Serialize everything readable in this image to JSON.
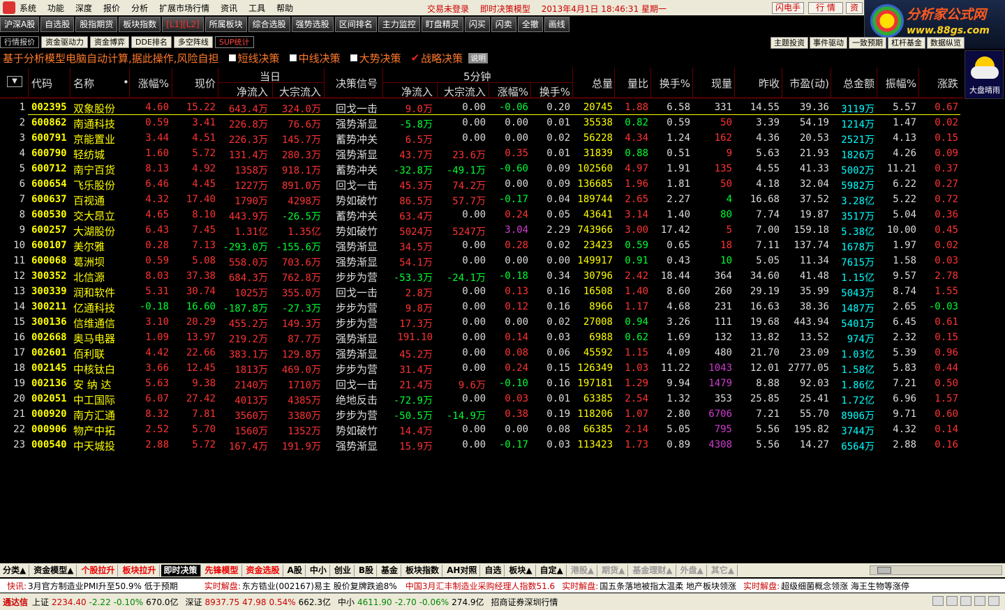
{
  "menu": {
    "items": [
      "系统",
      "功能",
      "深度",
      "报价",
      "分析",
      "扩展市场行情",
      "资讯",
      "工具",
      "帮助"
    ],
    "trade_status": "交易未登录",
    "model_name": "即时决策模型",
    "datetime": "2013年4月1日  18:46:31  星期一",
    "btn_flash": "闪电手",
    "btn_quote": "行 情",
    "btn_info": "资"
  },
  "brand": {
    "title": "分析家公式网",
    "url": "www.88gs.com"
  },
  "toolbar": [
    "沪深A股",
    "自选股",
    "股指期货",
    "板块指数",
    "[L1][L2]",
    "所属板块",
    "综合选股",
    "强势选股",
    "区间排名",
    "主力监控",
    "盯盘精灵",
    "闪买",
    "闪卖",
    "全撤",
    "画线"
  ],
  "tabs": [
    "行情报价",
    "资金驱动力",
    "资金博弈",
    "DDE排名",
    "多空阵线",
    "SUP统计"
  ],
  "right_tabs": [
    "主题投资",
    "事件驱动",
    "一致预期",
    "杠杆基金",
    "数据纵览"
  ],
  "dapan": "大盘晴雨",
  "strip": {
    "description": "基于分析模型电脑自动计算,据此操作,风险自担",
    "options": [
      {
        "label": "短线决策",
        "checked": false
      },
      {
        "label": "中线决策",
        "checked": false
      },
      {
        "label": "大势决策",
        "checked": false
      },
      {
        "label": "战略决策",
        "checked": true
      }
    ],
    "explain": "说明"
  },
  "header": {
    "sort_icon": "▼",
    "code": "代码",
    "name": "名称",
    "dot": "•",
    "chg": "涨幅%",
    "price": "现价",
    "group_day": "当日",
    "net_in": "净流入",
    "big_in": "大宗流入",
    "signal": "决策信号",
    "group_5m": "5分钟",
    "net_in5": "净流入",
    "big_in5": "大宗流入",
    "chg5": "涨幅%",
    "hs5": "换手%",
    "vol": "总量",
    "lb": "量比",
    "hs": "换手%",
    "cur": "现量",
    "pc": "昨收",
    "pe": "市盈(动)",
    "amt": "总金额",
    "amp": "振幅%",
    "zd": "涨跌"
  },
  "rows": [
    {
      "no": "1",
      "code": "002395",
      "name": "双象股份",
      "chg": "4.60",
      "price": "15.22",
      "in": "643.4万",
      "big": "324.0万",
      "sig": "回戈一击",
      "in5": "9.0万",
      "big5": "0.00",
      "chg5": "-0.06",
      "hs5": "0.20",
      "vol": "20745",
      "lb": "1.88",
      "hs": "6.58",
      "cur": "331",
      "pc": "14.55",
      "pe": "39.36",
      "amt": "3119万",
      "amp": "5.57",
      "zd": "0.67",
      "c": [
        "red",
        "red",
        "red",
        "red",
        "red",
        "wht",
        "grn",
        "red",
        "wht",
        "red"
      ]
    },
    {
      "no": "2",
      "code": "600862",
      "name": "南通科技",
      "chg": "0.59",
      "price": "3.41",
      "in": "226.8万",
      "big": "76.6万",
      "sig": "强势渐显",
      "in5": "-5.8万",
      "big5": "0.00",
      "chg5": "0.00",
      "hs5": "0.01",
      "vol": "35538",
      "lb": "0.82",
      "hs": "0.59",
      "cur": "50",
      "pc": "3.39",
      "pe": "54.19",
      "amt": "1214万",
      "amp": "1.47",
      "zd": "0.02",
      "c": [
        "red",
        "red",
        "red",
        "red",
        "grn",
        "wht",
        "wht",
        "grn",
        "red",
        "red"
      ]
    },
    {
      "no": "3",
      "code": "600791",
      "name": "京能置业",
      "chg": "3.44",
      "price": "4.51",
      "in": "226.3万",
      "big": "145.7万",
      "sig": "蓄势冲关",
      "in5": "6.5万",
      "big5": "0.00",
      "chg5": "0.00",
      "hs5": "0.02",
      "vol": "56228",
      "lb": "4.34",
      "hs": "1.24",
      "cur": "162",
      "pc": "4.36",
      "pe": "20.53",
      "amt": "2521万",
      "amp": "4.13",
      "zd": "0.15",
      "c": [
        "red",
        "red",
        "red",
        "red",
        "red",
        "wht",
        "wht",
        "red",
        "red",
        "red"
      ]
    },
    {
      "no": "4",
      "code": "600790",
      "name": "轻纺城",
      "chg": "1.60",
      "price": "5.72",
      "in": "131.4万",
      "big": "280.3万",
      "sig": "强势渐显",
      "in5": "43.7万",
      "big5": "23.6万",
      "chg5": "0.35",
      "hs5": "0.01",
      "vol": "31839",
      "lb": "0.88",
      "hs": "0.51",
      "cur": "9",
      "pc": "5.63",
      "pe": "21.93",
      "amt": "1826万",
      "amp": "4.26",
      "zd": "0.09",
      "c": [
        "red",
        "red",
        "red",
        "red",
        "red",
        "red",
        "red",
        "grn",
        "red",
        "red"
      ]
    },
    {
      "no": "5",
      "code": "600712",
      "name": "南宁百货",
      "chg": "8.13",
      "price": "4.92",
      "in": "1358万",
      "big": "918.1万",
      "sig": "蓄势冲关",
      "in5": "-32.8万",
      "big5": "-49.1万",
      "chg5": "-0.60",
      "hs5": "0.09",
      "vol": "102560",
      "lb": "4.97",
      "hs": "1.91",
      "cur": "135",
      "pc": "4.55",
      "pe": "41.33",
      "amt": "5002万",
      "amp": "11.21",
      "zd": "0.37",
      "c": [
        "red",
        "red",
        "red",
        "red",
        "grn",
        "grn",
        "grn",
        "red",
        "red",
        "red"
      ]
    },
    {
      "no": "6",
      "code": "600654",
      "name": "飞乐股份",
      "chg": "6.46",
      "price": "4.45",
      "in": "1227万",
      "big": "891.0万",
      "sig": "回戈一击",
      "in5": "45.3万",
      "big5": "74.2万",
      "chg5": "0.00",
      "hs5": "0.09",
      "vol": "136685",
      "lb": "1.96",
      "hs": "1.81",
      "cur": "50",
      "pc": "4.18",
      "pe": "32.04",
      "amt": "5982万",
      "amp": "6.22",
      "zd": "0.27",
      "c": [
        "red",
        "red",
        "red",
        "red",
        "red",
        "red",
        "wht",
        "red",
        "red",
        "red"
      ]
    },
    {
      "no": "7",
      "code": "600637",
      "name": "百视通",
      "chg": "4.32",
      "price": "17.40",
      "in": "1790万",
      "big": "4298万",
      "sig": "势如破竹",
      "in5": "86.5万",
      "big5": "57.7万",
      "chg5": "-0.17",
      "hs5": "0.04",
      "vol": "189744",
      "lb": "2.65",
      "hs": "2.27",
      "cur": "4",
      "pc": "16.68",
      "pe": "37.52",
      "amt": "3.28亿",
      "amp": "5.22",
      "zd": "0.72",
      "c": [
        "red",
        "red",
        "red",
        "red",
        "red",
        "red",
        "grn",
        "red",
        "grn",
        "red"
      ]
    },
    {
      "no": "8",
      "code": "600530",
      "name": "交大昂立",
      "chg": "4.65",
      "price": "8.10",
      "in": "443.9万",
      "big": "-26.5万",
      "sig": "蓄势冲关",
      "in5": "63.4万",
      "big5": "0.00",
      "chg5": "0.24",
      "hs5": "0.05",
      "vol": "43641",
      "lb": "3.14",
      "hs": "1.40",
      "cur": "80",
      "pc": "7.74",
      "pe": "19.87",
      "amt": "3517万",
      "amp": "5.04",
      "zd": "0.36",
      "c": [
        "red",
        "red",
        "red",
        "grn",
        "red",
        "wht",
        "red",
        "red",
        "grn",
        "red"
      ]
    },
    {
      "no": "9",
      "code": "600257",
      "name": "大湖股份",
      "chg": "6.43",
      "price": "7.45",
      "in": "1.31亿",
      "big": "1.35亿",
      "sig": "势如破竹",
      "in5": "5024万",
      "big5": "5247万",
      "chg5": "3.04",
      "hs5": "2.29",
      "vol": "743966",
      "lb": "3.00",
      "hs": "17.42",
      "cur": "5",
      "pc": "7.00",
      "pe": "159.18",
      "amt": "5.38亿",
      "amp": "10.00",
      "zd": "0.45",
      "c": [
        "red",
        "red",
        "red",
        "red",
        "red",
        "red",
        "mag",
        "red",
        "red",
        "red"
      ]
    },
    {
      "no": "10",
      "code": "600107",
      "name": "美尔雅",
      "chg": "0.28",
      "price": "7.13",
      "in": "-293.0万",
      "big": "-155.6万",
      "sig": "强势渐显",
      "in5": "34.5万",
      "big5": "0.00",
      "chg5": "0.28",
      "hs5": "0.02",
      "vol": "23423",
      "lb": "0.59",
      "hs": "0.65",
      "cur": "18",
      "pc": "7.11",
      "pe": "137.74",
      "amt": "1678万",
      "amp": "1.97",
      "zd": "0.02",
      "c": [
        "red",
        "red",
        "grn",
        "grn",
        "red",
        "wht",
        "red",
        "grn",
        "red",
        "red"
      ]
    },
    {
      "no": "11",
      "code": "600068",
      "name": "葛洲坝",
      "chg": "0.59",
      "price": "5.08",
      "in": "558.0万",
      "big": "703.6万",
      "sig": "强势渐显",
      "in5": "54.1万",
      "big5": "0.00",
      "chg5": "0.00",
      "hs5": "0.00",
      "vol": "149917",
      "lb": "0.91",
      "hs": "0.43",
      "cur": "10",
      "pc": "5.05",
      "pe": "11.34",
      "amt": "7615万",
      "amp": "1.58",
      "zd": "0.03",
      "c": [
        "red",
        "red",
        "red",
        "red",
        "red",
        "wht",
        "wht",
        "grn",
        "grn",
        "red"
      ]
    },
    {
      "no": "12",
      "code": "300352",
      "name": "北信源",
      "chg": "8.03",
      "price": "37.38",
      "in": "684.3万",
      "big": "762.8万",
      "sig": "步步为营",
      "in5": "-53.3万",
      "big5": "-24.1万",
      "chg5": "-0.18",
      "hs5": "0.34",
      "vol": "30796",
      "lb": "2.42",
      "hs": "18.44",
      "cur": "364",
      "pc": "34.60",
      "pe": "41.48",
      "amt": "1.15亿",
      "amp": "9.57",
      "zd": "2.78",
      "c": [
        "red",
        "red",
        "red",
        "red",
        "grn",
        "grn",
        "grn",
        "red",
        "wht",
        "red"
      ]
    },
    {
      "no": "13",
      "code": "300339",
      "name": "润和软件",
      "chg": "5.31",
      "price": "30.74",
      "in": "1025万",
      "big": "355.0万",
      "sig": "回戈一击",
      "in5": "2.8万",
      "big5": "0.00",
      "chg5": "0.13",
      "hs5": "0.16",
      "vol": "16508",
      "lb": "1.40",
      "hs": "8.60",
      "cur": "260",
      "pc": "29.19",
      "pe": "35.99",
      "amt": "5043万",
      "amp": "8.74",
      "zd": "1.55",
      "c": [
        "red",
        "red",
        "red",
        "red",
        "red",
        "wht",
        "red",
        "red",
        "wht",
        "red"
      ]
    },
    {
      "no": "14",
      "code": "300211",
      "name": "亿通科技",
      "chg": "-0.18",
      "price": "16.60",
      "in": "-187.8万",
      "big": "-27.3万",
      "sig": "步步为营",
      "in5": "9.8万",
      "big5": "0.00",
      "chg5": "0.12",
      "hs5": "0.16",
      "vol": "8966",
      "lb": "1.17",
      "hs": "4.68",
      "cur": "231",
      "pc": "16.63",
      "pe": "38.36",
      "amt": "1487万",
      "amp": "2.65",
      "zd": "-0.03",
      "c": [
        "grn",
        "grn",
        "grn",
        "grn",
        "red",
        "wht",
        "red",
        "red",
        "wht",
        "grn"
      ]
    },
    {
      "no": "15",
      "code": "300136",
      "name": "信维通信",
      "chg": "3.10",
      "price": "20.29",
      "in": "455.2万",
      "big": "149.3万",
      "sig": "步步为营",
      "in5": "17.3万",
      "big5": "0.00",
      "chg5": "0.00",
      "hs5": "0.02",
      "vol": "27008",
      "lb": "0.94",
      "hs": "3.26",
      "cur": "111",
      "pc": "19.68",
      "pe": "443.94",
      "amt": "5401万",
      "amp": "6.45",
      "zd": "0.61",
      "c": [
        "red",
        "red",
        "red",
        "red",
        "red",
        "wht",
        "wht",
        "grn",
        "wht",
        "red"
      ]
    },
    {
      "no": "16",
      "code": "002668",
      "name": "奥马电器",
      "chg": "1.09",
      "price": "13.97",
      "in": "219.2万",
      "big": "87.7万",
      "sig": "强势渐显",
      "in5": "191.10",
      "big5": "0.00",
      "chg5": "0.14",
      "hs5": "0.03",
      "vol": "6988",
      "lb": "0.62",
      "hs": "1.69",
      "cur": "132",
      "pc": "13.82",
      "pe": "13.52",
      "amt": "974万",
      "amp": "2.32",
      "zd": "0.15",
      "c": [
        "red",
        "red",
        "red",
        "red",
        "red",
        "wht",
        "red",
        "grn",
        "wht",
        "red"
      ]
    },
    {
      "no": "17",
      "code": "002601",
      "name": "佰利联",
      "chg": "4.42",
      "price": "22.66",
      "in": "383.1万",
      "big": "129.8万",
      "sig": "强势渐显",
      "in5": "45.2万",
      "big5": "0.00",
      "chg5": "0.08",
      "hs5": "0.06",
      "vol": "45592",
      "lb": "1.15",
      "hs": "4.09",
      "cur": "480",
      "pc": "21.70",
      "pe": "23.09",
      "amt": "1.03亿",
      "amp": "5.39",
      "zd": "0.96",
      "c": [
        "red",
        "red",
        "red",
        "red",
        "red",
        "wht",
        "red",
        "red",
        "wht",
        "red"
      ]
    },
    {
      "no": "18",
      "code": "002145",
      "name": "中核钛白",
      "chg": "3.66",
      "price": "12.45",
      "in": "1813万",
      "big": "469.0万",
      "sig": "步步为营",
      "in5": "31.4万",
      "big5": "0.00",
      "chg5": "0.24",
      "hs5": "0.15",
      "vol": "126349",
      "lb": "1.03",
      "hs": "11.22",
      "cur": "1043",
      "pc": "12.01",
      "pe": "2777.05",
      "amt": "1.58亿",
      "amp": "5.83",
      "zd": "0.44",
      "c": [
        "red",
        "red",
        "red",
        "red",
        "red",
        "wht",
        "red",
        "red",
        "mag",
        "red"
      ]
    },
    {
      "no": "19",
      "code": "002136",
      "name": "安 纳 达",
      "chg": "5.63",
      "price": "9.38",
      "in": "2140万",
      "big": "1710万",
      "sig": "回戈一击",
      "in5": "21.4万",
      "big5": "9.6万",
      "chg5": "-0.10",
      "hs5": "0.16",
      "vol": "197181",
      "lb": "1.29",
      "hs": "9.94",
      "cur": "1479",
      "pc": "8.88",
      "pe": "92.03",
      "amt": "1.86亿",
      "amp": "7.21",
      "zd": "0.50",
      "c": [
        "red",
        "red",
        "red",
        "red",
        "red",
        "red",
        "grn",
        "red",
        "mag",
        "red"
      ]
    },
    {
      "no": "20",
      "code": "002051",
      "name": "中工国际",
      "chg": "6.07",
      "price": "27.42",
      "in": "4013万",
      "big": "4385万",
      "sig": "绝地反击",
      "in5": "-72.9万",
      "big5": "0.00",
      "chg5": "0.03",
      "hs5": "0.01",
      "vol": "63385",
      "lb": "2.54",
      "hs": "1.32",
      "cur": "353",
      "pc": "25.85",
      "pe": "25.41",
      "amt": "1.72亿",
      "amp": "6.96",
      "zd": "1.57",
      "c": [
        "red",
        "red",
        "red",
        "red",
        "grn",
        "wht",
        "red",
        "red",
        "wht",
        "red"
      ]
    },
    {
      "no": "21",
      "code": "000920",
      "name": "南方汇通",
      "chg": "8.32",
      "price": "7.81",
      "in": "3560万",
      "big": "3380万",
      "sig": "步步为营",
      "in5": "-50.5万",
      "big5": "-14.9万",
      "chg5": "0.38",
      "hs5": "0.19",
      "vol": "118206",
      "lb": "1.07",
      "hs": "2.80",
      "cur": "6706",
      "pc": "7.21",
      "pe": "55.70",
      "amt": "8906万",
      "amp": "9.71",
      "zd": "0.60",
      "c": [
        "red",
        "red",
        "red",
        "red",
        "grn",
        "grn",
        "red",
        "red",
        "mag",
        "red"
      ]
    },
    {
      "no": "22",
      "code": "000906",
      "name": "物产中拓",
      "chg": "2.52",
      "price": "5.70",
      "in": "1560万",
      "big": "1352万",
      "sig": "势如破竹",
      "in5": "14.4万",
      "big5": "0.00",
      "chg5": "0.00",
      "hs5": "0.08",
      "vol": "66385",
      "lb": "2.14",
      "hs": "5.05",
      "cur": "795",
      "pc": "5.56",
      "pe": "195.82",
      "amt": "3744万",
      "amp": "4.32",
      "zd": "0.14",
      "c": [
        "red",
        "red",
        "red",
        "red",
        "red",
        "wht",
        "wht",
        "red",
        "mag",
        "red"
      ]
    },
    {
      "no": "23",
      "code": "000540",
      "name": "中天城投",
      "chg": "2.88",
      "price": "5.72",
      "in": "167.4万",
      "big": "191.9万",
      "sig": "强势渐显",
      "in5": "15.9万",
      "big5": "0.00",
      "chg5": "-0.17",
      "hs5": "0.03",
      "vol": "113423",
      "lb": "1.73",
      "hs": "0.89",
      "cur": "4308",
      "pc": "5.56",
      "pe": "14.27",
      "amt": "6564万",
      "amp": "2.88",
      "zd": "0.16",
      "c": [
        "red",
        "red",
        "red",
        "red",
        "red",
        "wht",
        "grn",
        "red",
        "mag",
        "red"
      ]
    }
  ],
  "bottom_tabs": [
    {
      "label": "分类▲",
      "style": ""
    },
    {
      "label": "资金模型▲",
      "style": ""
    },
    {
      "label": "个股拉升",
      "style": "r"
    },
    {
      "label": "板块拉升",
      "style": "r"
    },
    {
      "label": "即时决策",
      "style": "act"
    },
    {
      "label": "先锋模型",
      "style": "r"
    },
    {
      "label": "资金选股",
      "style": "r"
    },
    {
      "label": "A股",
      "style": ""
    },
    {
      "label": "中小",
      "style": ""
    },
    {
      "label": "创业",
      "style": ""
    },
    {
      "label": "B股",
      "style": ""
    },
    {
      "label": "基金",
      "style": ""
    },
    {
      "label": "板块指数",
      "style": ""
    },
    {
      "label": "AH对照",
      "style": ""
    },
    {
      "label": "自选",
      "style": ""
    },
    {
      "label": "板块▲",
      "style": ""
    },
    {
      "label": "自定▲",
      "style": ""
    },
    {
      "label": "港股▲",
      "style": "g"
    },
    {
      "label": "期货▲",
      "style": "g"
    },
    {
      "label": "基金理财▲",
      "style": "g"
    },
    {
      "label": "外盘▲",
      "style": "g"
    },
    {
      "label": "其它▲",
      "style": "g"
    }
  ],
  "ticker": [
    {
      "label": "快讯:",
      "text": "3月官方制造业PMI升至50.9% 低于预期"
    },
    {
      "label": "实时解盘:",
      "text": "东方锆业(002167)易主 股价复牌跌逾8%"
    },
    {
      "label": "",
      "text": "中国3月汇丰制造业采购经理人指数51.6"
    },
    {
      "label": "实时解盘:",
      "text": "国五条落地被指太温柔 地产板块领涨"
    },
    {
      "label": "实时解盘:",
      "text": "超级细菌概念领涨 海王生物等涨停"
    }
  ],
  "status": {
    "app": "通达信",
    "sh": {
      "name": "上证",
      "val": "2234.40",
      "chg": "-2.22",
      "pct": "-0.10%",
      "amt": "670.0亿"
    },
    "sz": {
      "name": "深证",
      "val": "8937.75",
      "chg": "47.98",
      "pct": "0.54%",
      "amt": "662.3亿"
    },
    "zx": {
      "name": "中小",
      "val": "4611.90",
      "chg": "-2.70",
      "pct": "-0.06%",
      "amt": "274.9亿"
    },
    "broker": "招商证券深圳行情"
  }
}
